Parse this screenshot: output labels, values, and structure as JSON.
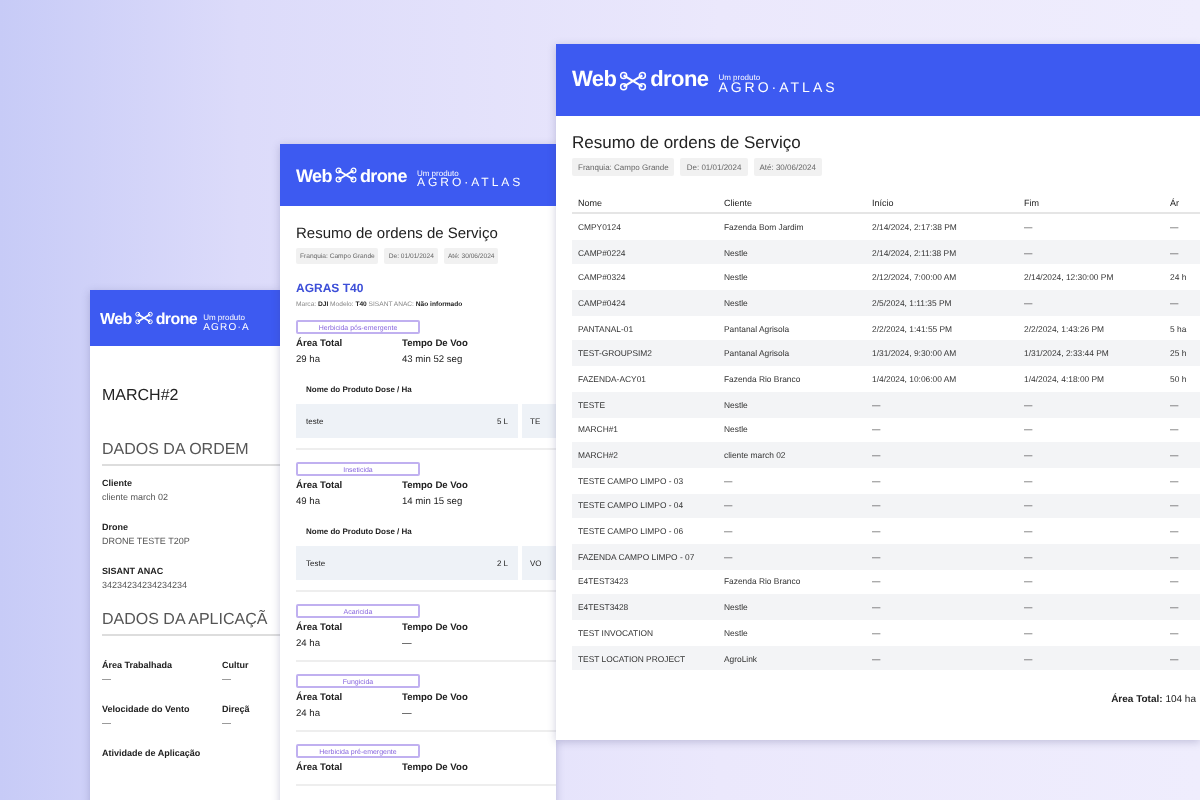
{
  "order_detail": {
    "logo": {
      "brand_start": "Web",
      "brand_end": "drone",
      "tagline": "Um produto",
      "partner": "AGRO·A"
    },
    "title": "MARCH#2",
    "sections": [
      {
        "heading": "DADOS DA ORDEM",
        "kind": "stack",
        "fields": [
          {
            "label": "Cliente",
            "value": "cliente march 02"
          },
          {
            "label": "Drone",
            "value": "DRONE TESTE T20P"
          },
          {
            "label": "SISANT ANAC",
            "value": "34234234234234234"
          }
        ]
      },
      {
        "heading": "DADOS DA APLICAÇÃ",
        "kind": "grid",
        "fields": [
          {
            "label": "Área Trabalhada",
            "value": "—"
          },
          {
            "label": "Cultur",
            "value": "—"
          },
          {
            "label": "Velocidade do Vento",
            "value": "—"
          },
          {
            "label": "Direçã",
            "value": "—"
          },
          {
            "label": "Atividade de Aplicação"
          }
        ]
      }
    ]
  },
  "summary_card": {
    "logo": {
      "brand_start": "Web",
      "brand_end": "drone",
      "tagline": "Um produto",
      "partner": "AGRO·ATLAS"
    },
    "title": "Resumo de ordens de Serviço",
    "filters": [
      "Franquia: Campo Grande",
      "De: 01/01/2024",
      "Até: 30/06/2024"
    ],
    "drone": {
      "name": "AGRAS T40",
      "specs": "Marca: **DJI** Modelo: **T40** SISANT ANAC: **Não informado**"
    },
    "applications": [
      {
        "type": "Herbicida pós-emergente",
        "area_label": "Área Total",
        "area": "29 ha",
        "time_label": "Tempo De Voo",
        "time": "43 min 52 seg",
        "products_header": "Nome do Produto Dose / Ha",
        "products": [
          {
            "name": "teste",
            "dose": "5 L",
            "column_3": "TE"
          }
        ]
      },
      {
        "type": "Inseticida",
        "area_label": "Área Total",
        "area": "49 ha",
        "time_label": "Tempo De Voo",
        "time": "14 min 15 seg",
        "products_header": "Nome do Produto Dose / Ha",
        "products": [
          {
            "name": "Teste",
            "dose": "2 L",
            "column_3": "VO"
          }
        ]
      },
      {
        "type": "Acaricida",
        "area_label": "Área Total",
        "area": "24 ha",
        "time_label": "Tempo De Voo",
        "time": "—"
      },
      {
        "type": "Fungicida",
        "area_label": "Área Total",
        "area": "24 ha",
        "time_label": "Tempo De Voo",
        "time": "—"
      },
      {
        "type": "Herbicida pré-emergente",
        "area_label": "Área Total",
        "time_label": "Tempo De Voo"
      }
    ]
  },
  "summary_table": {
    "logo": {
      "brand_start": "Web",
      "brand_end": "drone",
      "tagline": "Um produto",
      "partner": "AGRO·ATLAS"
    },
    "title": "Resumo de ordens de Serviço",
    "filters": [
      "Franquia: Campo Grande",
      "De: 01/01/2024",
      "Até: 30/06/2024"
    ],
    "columns": [
      "Nome",
      "Cliente",
      "Início",
      "Fim",
      "Ár"
    ],
    "rows": [
      [
        "CMPY0124",
        "Fazenda Bom Jardim",
        "2/14/2024, 2:17:38 PM",
        "—",
        "—"
      ],
      [
        "CAMP#0224",
        "Nestle",
        "2/14/2024, 2:11:38 PM",
        "—",
        "—"
      ],
      [
        "CAMP#0324",
        "Nestle",
        "2/12/2024, 7:00:00 AM",
        "2/14/2024, 12:30:00 PM",
        "24 h"
      ],
      [
        "CAMP#0424",
        "Nestle",
        "2/5/2024, 1:11:35 PM",
        "—",
        "—"
      ],
      [
        "PANTANAL-01",
        "Pantanal Agrisola",
        "2/2/2024, 1:41:55 PM",
        "2/2/2024, 1:43:26 PM",
        "5 ha"
      ],
      [
        "TEST-GROUPSIM2",
        "Pantanal Agrisola",
        "1/31/2024, 9:30:00 AM",
        "1/31/2024, 2:33:44 PM",
        "25 h"
      ],
      [
        "FAZENDA-ACY01",
        "Fazenda Rio Branco",
        "1/4/2024, 10:06:00 AM",
        "1/4/2024, 4:18:00 PM",
        "50 h"
      ],
      [
        "TESTE",
        "Nestle",
        "—",
        "—",
        "—"
      ],
      [
        "MARCH#1",
        "Nestle",
        "—",
        "—",
        "—"
      ],
      [
        "MARCH#2",
        "cliente march 02",
        "—",
        "—",
        "—"
      ],
      [
        "TESTE CAMPO LIMPO - 03",
        "—",
        "—",
        "—",
        "—"
      ],
      [
        "TESTE CAMPO LIMPO - 04",
        "—",
        "—",
        "—",
        "—"
      ],
      [
        "TESTE CAMPO LIMPO - 06",
        "—",
        "—",
        "—",
        "—"
      ],
      [
        "FAZENDA CAMPO LIMPO - 07",
        "—",
        "—",
        "—",
        "—"
      ],
      [
        "E4TEST3423",
        "Fazenda Rio Branco",
        "—",
        "—",
        "—"
      ],
      [
        "E4TEST3428",
        "Nestle",
        "—",
        "—",
        "—"
      ],
      [
        "TEST INVOCATION",
        "Nestle",
        "—",
        "—",
        "—"
      ],
      [
        "TEST LOCATION PROJECT",
        "AgroLink",
        "—",
        "—",
        "—"
      ]
    ],
    "total_label": "Área Total:",
    "total": "104 ha"
  }
}
